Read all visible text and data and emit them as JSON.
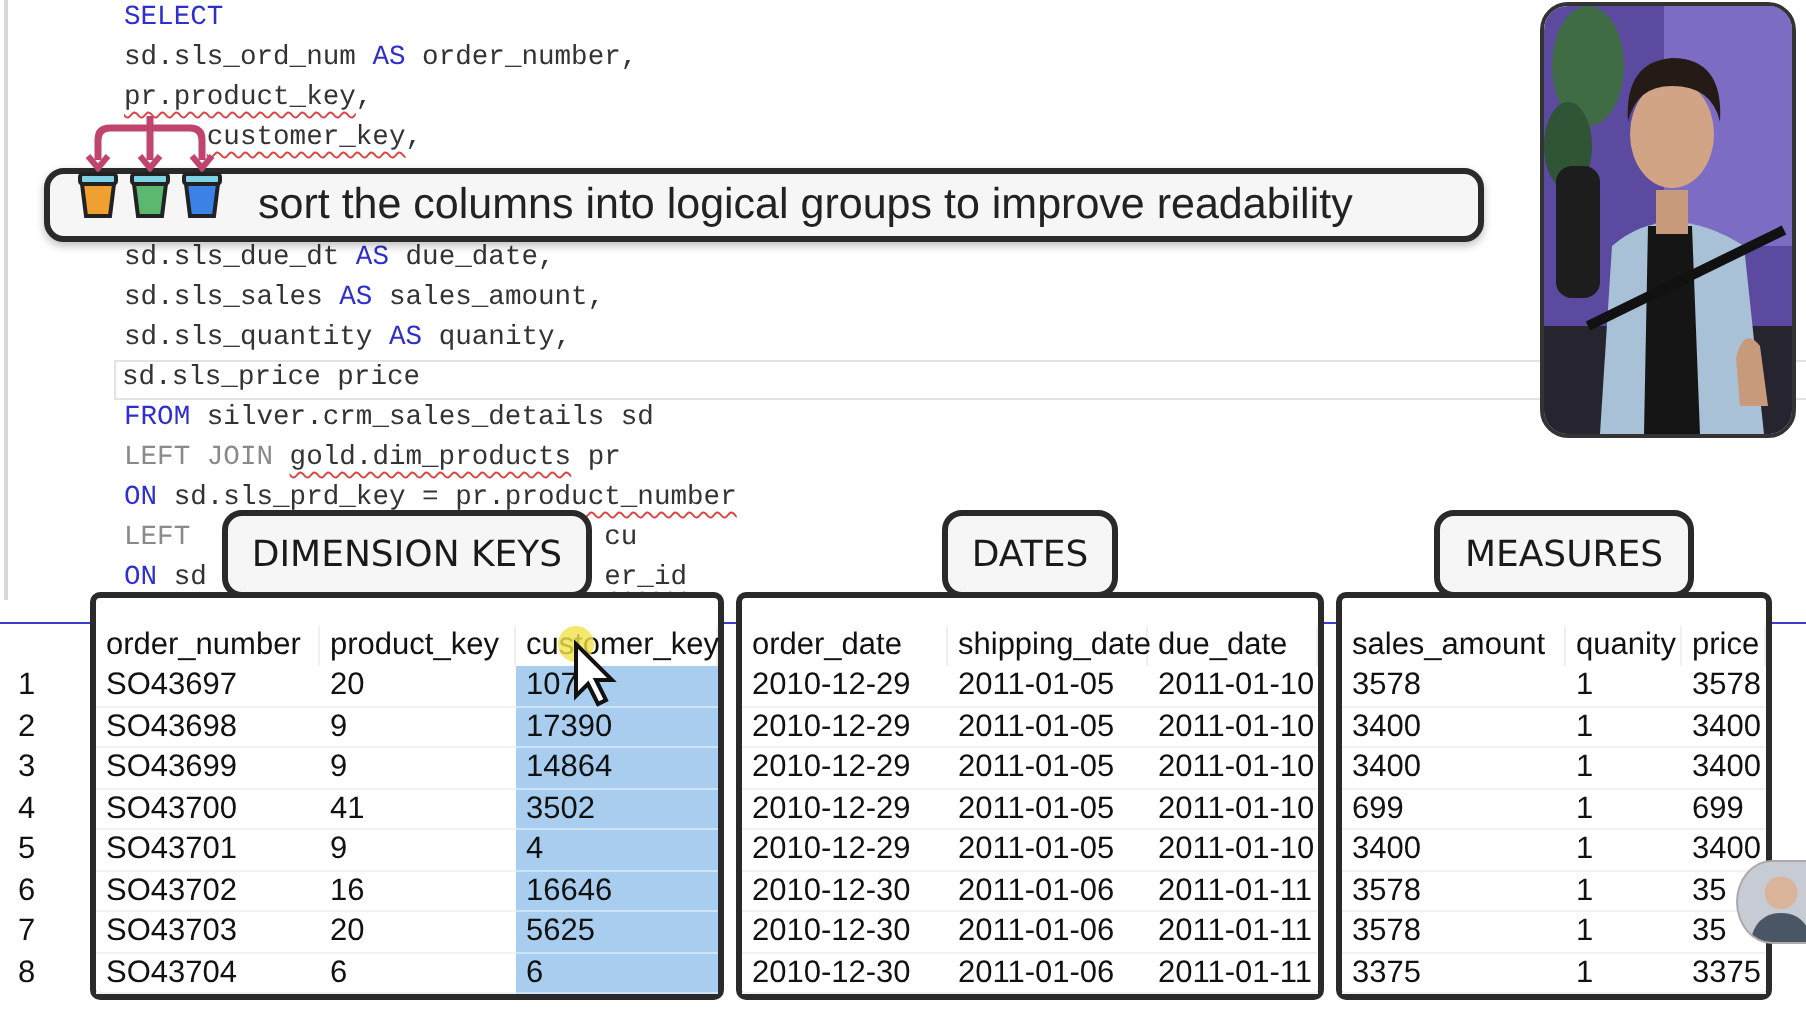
{
  "editor": {
    "lines": [
      {
        "segments": [
          {
            "text": "SELECT",
            "kind": "keyword"
          }
        ]
      },
      {
        "segments": [
          {
            "text": "sd.sls_ord_num ",
            "kind": "plain"
          },
          {
            "text": "AS",
            "kind": "keyword"
          },
          {
            "text": " order_number,",
            "kind": "plain"
          }
        ]
      },
      {
        "segments": [
          {
            "text": "pr.product_key",
            "kind": "plain",
            "squiggle": true
          },
          {
            "text": ",",
            "kind": "plain"
          }
        ]
      },
      {
        "segments": [
          {
            "text": "customer_key",
            "kind": "plain",
            "squiggle": true,
            "after_cover": true
          },
          {
            "text": ",",
            "kind": "plain"
          }
        ]
      },
      {
        "below_banner": true,
        "segments": [
          {
            "text": "sd.sls_due_dt ",
            "kind": "plain"
          },
          {
            "text": "AS",
            "kind": "keyword"
          },
          {
            "text": " due_date,",
            "kind": "plain"
          }
        ]
      },
      {
        "segments": [
          {
            "text": "sd.sls_sales ",
            "kind": "plain"
          },
          {
            "text": "AS",
            "kind": "keyword"
          },
          {
            "text": " sales_amount,",
            "kind": "plain"
          }
        ]
      },
      {
        "segments": [
          {
            "text": "sd.sls_quantity ",
            "kind": "plain"
          },
          {
            "text": "AS",
            "kind": "keyword"
          },
          {
            "text": " quanity,",
            "kind": "plain"
          }
        ]
      },
      {
        "current": true,
        "segments": [
          {
            "text": "sd.sls_price price",
            "kind": "plain"
          }
        ]
      },
      {
        "segments": [
          {
            "text": "FROM",
            "kind": "keyword"
          },
          {
            "text": " silver.crm_sales_details sd",
            "kind": "plain"
          }
        ]
      },
      {
        "segments": [
          {
            "text": "LEFT JOIN ",
            "kind": "join"
          },
          {
            "text": "gold.dim_products",
            "kind": "plain",
            "squiggle": true
          },
          {
            "text": " pr",
            "kind": "plain"
          }
        ]
      },
      {
        "segments": [
          {
            "text": "ON",
            "kind": "keyword"
          },
          {
            "text": " sd.sls_prd_key = ",
            "kind": "plain"
          },
          {
            "text": "pr.product_number",
            "kind": "plain",
            "squiggle": true
          }
        ]
      },
      {
        "segments": [
          {
            "text": "LEFT",
            "kind": "join"
          }
        ],
        "right_segments": [
          {
            "text": "cu",
            "kind": "plain"
          }
        ]
      },
      {
        "segments": [
          {
            "text": "ON",
            "kind": "keyword"
          },
          {
            "text": " sd",
            "kind": "plain"
          }
        ],
        "right_segments": [
          {
            "text": "er_id",
            "kind": "plain",
            "squiggle": true
          }
        ]
      }
    ]
  },
  "banner": {
    "text": "sort the columns into logical groups to improve readability"
  },
  "table": {
    "groups": [
      {
        "label": "DIMENSION KEYS",
        "columns": [
          {
            "name": "order_number",
            "selected": false
          },
          {
            "name": "product_key",
            "selected": false
          },
          {
            "name": "customer_key",
            "selected": true
          }
        ]
      },
      {
        "label": "DATES",
        "columns": [
          {
            "name": "order_date",
            "selected": false
          },
          {
            "name": "shipping_date",
            "selected": false
          },
          {
            "name": "due_date",
            "selected": false
          }
        ]
      },
      {
        "label": "MEASURES",
        "columns": [
          {
            "name": "sales_amount",
            "selected": false
          },
          {
            "name": "quanity",
            "selected": false
          },
          {
            "name": "price",
            "selected": false
          }
        ]
      }
    ],
    "rows": [
      {
        "number": "1",
        "cells": [
          "SO43697",
          "20",
          "107",
          "2010-12-29",
          "2011-01-05",
          "2011-01-10",
          "3578",
          "1",
          "3578"
        ]
      },
      {
        "number": "2",
        "cells": [
          "SO43698",
          "9",
          "17390",
          "2010-12-29",
          "2011-01-05",
          "2011-01-10",
          "3400",
          "1",
          "3400"
        ]
      },
      {
        "number": "3",
        "cells": [
          "SO43699",
          "9",
          "14864",
          "2010-12-29",
          "2011-01-05",
          "2011-01-10",
          "3400",
          "1",
          "3400"
        ]
      },
      {
        "number": "4",
        "cells": [
          "SO43700",
          "41",
          "3502",
          "2010-12-29",
          "2011-01-05",
          "2011-01-10",
          "699",
          "1",
          "699"
        ]
      },
      {
        "number": "5",
        "cells": [
          "SO43701",
          "9",
          "4",
          "2010-12-29",
          "2011-01-05",
          "2011-01-10",
          "3400",
          "1",
          "3400"
        ]
      },
      {
        "number": "6",
        "cells": [
          "SO43702",
          "16",
          "16646",
          "2010-12-30",
          "2011-01-06",
          "2011-01-11",
          "3578",
          "1",
          "35"
        ]
      },
      {
        "number": "7",
        "cells": [
          "SO43703",
          "20",
          "5625",
          "2010-12-30",
          "2011-01-06",
          "2011-01-11",
          "3578",
          "1",
          "35"
        ]
      },
      {
        "number": "8",
        "cells": [
          "SO43704",
          "6",
          "6",
          "2010-12-30",
          "2011-01-06",
          "2011-01-11",
          "3375",
          "1",
          "3375"
        ]
      }
    ]
  }
}
